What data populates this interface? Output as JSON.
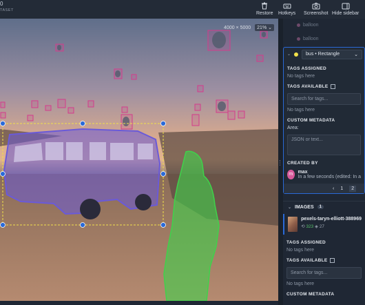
{
  "app": {
    "brand": "0",
    "brand_sub": "TASET"
  },
  "toolbar": {
    "restore_label": "Restore",
    "hotkeys_label": "Hotkeys",
    "screenshot_label": "Screenshot",
    "hide_sidebar_label": "Hide sidebar"
  },
  "canvas": {
    "dimensions": "4000 × 5000",
    "zoom": "21%"
  },
  "annotations_list": {
    "ghost_1": "balloon",
    "ghost_2": "balloon"
  },
  "selected_annotation": {
    "label": "bus • Rectangle",
    "color": "#f1e14a",
    "tags_assigned_title": "TAGS ASSIGNED",
    "no_tags_1": "No tags here",
    "tags_available_title": "TAGS AVAILABLE",
    "search_placeholder": "Search for tags...",
    "no_tags_2": "No tags here",
    "custom_metadata_title": "CUSTOM METADATA",
    "area_label": "Area:",
    "json_placeholder": "JSON or text...",
    "created_by_title": "CREATED BY",
    "author_initial": "m",
    "author_name": "max",
    "created_time": "In a few seconds (edited: In a"
  },
  "pagination": {
    "page_1": "1",
    "page_2": "2"
  },
  "images_panel": {
    "title": "IMAGES",
    "count": "1",
    "filename": "pexels-taryn-elliott-388969",
    "meta_count": "323",
    "meta_other": "27",
    "tags_assigned_title": "TAGS ASSIGNED",
    "no_tags_1": "No tags here",
    "tags_available_title": "TAGS AVAILABLE",
    "search_placeholder": "Search for tags...",
    "no_tags_2": "No tags here",
    "custom_metadata_title": "CUSTOM METADATA"
  },
  "colors": {
    "accent": "#2a6ad8",
    "bus_mask": "#6a5ad8",
    "person_mask": "#3fd24b",
    "balloon_box": "#d43b8c"
  }
}
